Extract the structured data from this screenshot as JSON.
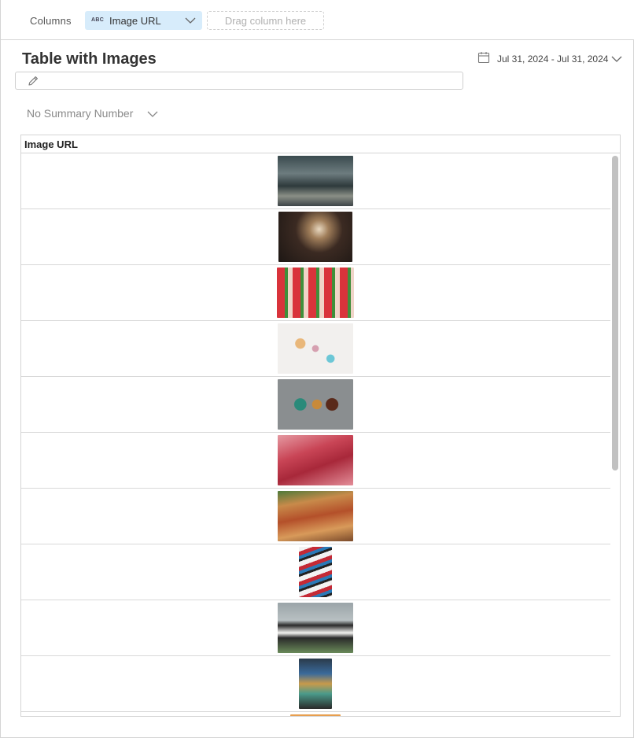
{
  "columns_bar": {
    "label": "Columns",
    "chip": {
      "type_badge": "ABC",
      "label": "Image URL"
    },
    "drop_placeholder": "Drag column here"
  },
  "title": "Table with Images",
  "date_range": "Jul 31, 2024 - Jul 31, 2024",
  "summary": {
    "selected": "No Summary Number"
  },
  "table": {
    "column_header": "Image URL",
    "rows": [
      {
        "image": "market-hall-photo"
      },
      {
        "image": "food-stall-photo"
      },
      {
        "image": "tomato-bowls-photo"
      },
      {
        "image": "ice-cream-cones-photo"
      },
      {
        "image": "nut-bowls-photo"
      },
      {
        "image": "raw-steak-photo"
      },
      {
        "image": "charcuterie-board-photo"
      },
      {
        "image": "chocolate-bars-photo"
      },
      {
        "image": "cows-photo"
      },
      {
        "image": "stacked-boxes-photo"
      },
      {
        "image": "food-photo"
      }
    ]
  },
  "colors": {
    "chip_bg": "#d7ecfb",
    "border": "#d4d4d4",
    "scrollbar": "#c1c1c1"
  }
}
